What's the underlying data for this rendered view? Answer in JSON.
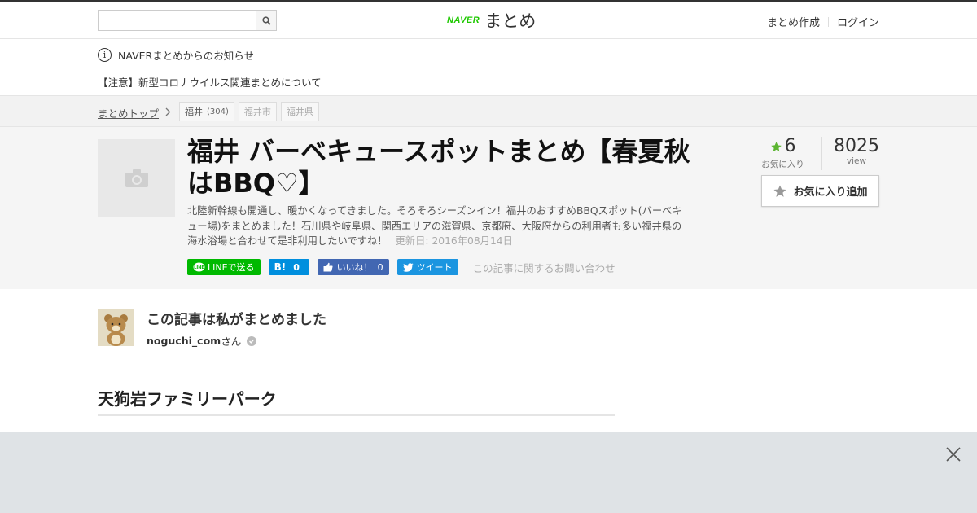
{
  "header": {
    "search_placeholder": "",
    "logo_brand": "NAVER",
    "logo_text": "まとめ",
    "links": [
      "まとめ作成",
      "ログイン"
    ]
  },
  "notice": {
    "heading": "NAVERまとめからのお知らせ",
    "link": "【注意】新型コロナウイルス関連まとめについて"
  },
  "breadcrumb": {
    "home": "まとめトップ",
    "tags": [
      {
        "label": "福井",
        "count": "(304)"
      },
      {
        "label": "福井市"
      },
      {
        "label": "福井県"
      }
    ]
  },
  "article": {
    "title": "福井 バーベキュースポットまとめ【春夏秋はBBQ♡】",
    "description": "北陸新幹線も開通し、暖かくなってきました。そろそろシーズンイン！福井のおすすめBBQスポット(バーベキュー場)をまとめました！石川県や岐阜県、関西エリアの滋賀県、京都府、大阪府からの利用者も多い福井県の海水浴場と合わせて是非利用したいですね！",
    "updated": "更新日: 2016年08月14日",
    "favorites_count": "6",
    "favorites_label": "お気に入り",
    "views_count": "8025",
    "views_label": "view",
    "fav_button": "お気に入り追加"
  },
  "share": {
    "line": "LINEで送る",
    "hatena_count": "0",
    "fb_label": "いいね！",
    "fb_count": "0",
    "tweet": "ツイート",
    "inquiry": "この記事に関するお問い合わせ"
  },
  "author": {
    "title": "この記事は私がまとめました",
    "name": "noguchi_com",
    "suffix": "さん"
  },
  "section": {
    "heading": "天狗岩ファミリーパーク"
  },
  "colors": {
    "naver_green": "#1ec800",
    "line_green": "#00b900",
    "hatena_blue": "#008fde",
    "facebook_blue": "#4267b2",
    "twitter_blue": "#1b95e0",
    "star_green": "#5bb531"
  }
}
